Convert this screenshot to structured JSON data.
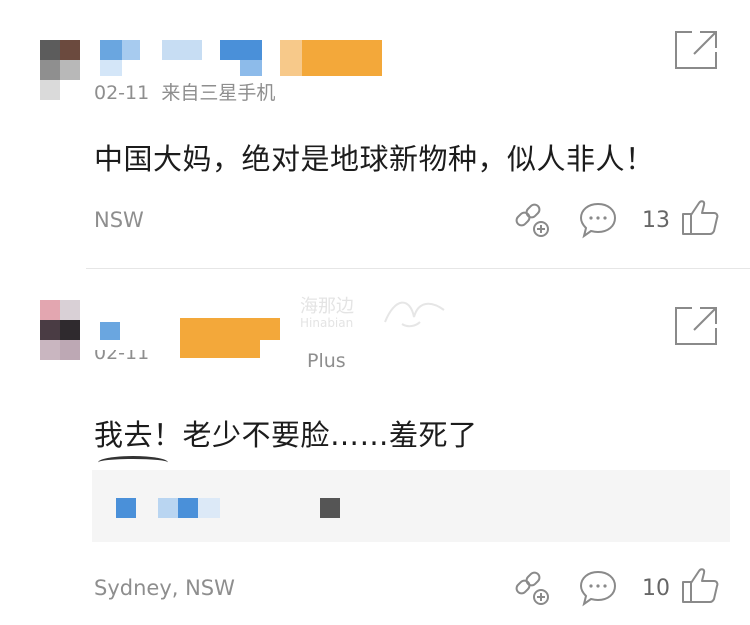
{
  "comments": [
    {
      "date": "02-11",
      "source": "来自三星手机",
      "content": "中国大妈，绝对是地球新物种，似人非人！",
      "location": "NSW",
      "likes": "13",
      "icons": [
        "share-icon",
        "comment-icon",
        "thumbs-up-icon",
        "expand-icon"
      ]
    },
    {
      "date": "02-11",
      "source": "Plus",
      "content": "我去！老少不要脸……羞死了",
      "location": "Sydney,  NSW",
      "likes": "10",
      "icons": [
        "share-icon",
        "comment-icon",
        "thumbs-up-icon",
        "expand-icon"
      ]
    }
  ],
  "watermark": {
    "cn": "海那边",
    "en": "Hinabian"
  },
  "colors": {
    "meta": "#8e8e8e",
    "icon": "#8a8a8a",
    "censor_orange": "#f3a83a",
    "censor_blue": "#4a90d9"
  }
}
